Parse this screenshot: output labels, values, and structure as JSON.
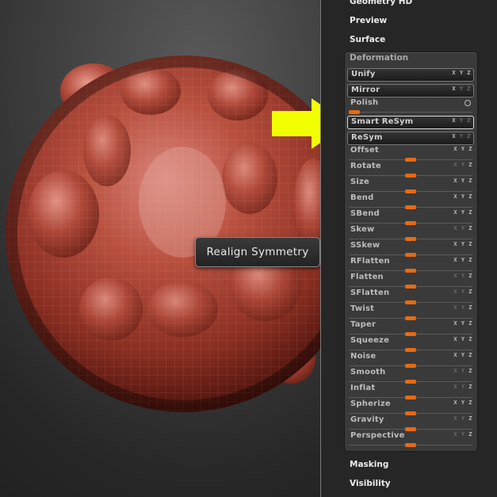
{
  "tooltip": {
    "text": "Realign Symmetry"
  },
  "palette": {
    "above": [
      "Geometry HD",
      "Preview",
      "Surface"
    ],
    "below": [
      "Masking",
      "Visibility"
    ]
  },
  "deformation": {
    "title": "Deformation",
    "buttons": [
      {
        "label": "Unify",
        "axes": "XYZ"
      },
      {
        "label": "Mirror",
        "axes": "XYZ"
      },
      {
        "label": "Polish",
        "type": "slider",
        "value": 0.05
      },
      {
        "label": "Smart ReSym",
        "axes": "XYZ",
        "highlight": true
      },
      {
        "label": "ReSym",
        "axes": "XYZ"
      }
    ],
    "sliders": [
      {
        "label": "Offset",
        "axes": "XYZ",
        "value": 0.5
      },
      {
        "label": "Rotate",
        "axes": "XYZ",
        "value": 0.5
      },
      {
        "label": "Size",
        "axes": "XYZ",
        "value": 0.5
      },
      {
        "label": "Bend",
        "axes": "XYZ",
        "value": 0.5
      },
      {
        "label": "SBend",
        "axes": "XYZ",
        "value": 0.5
      },
      {
        "label": "Skew",
        "axes": "XYZ",
        "value": 0.5
      },
      {
        "label": "SSkew",
        "axes": "XYZ",
        "value": 0.5
      },
      {
        "label": "RFlatten",
        "axes": "XYZ",
        "value": 0.5
      },
      {
        "label": "Flatten",
        "axes": "XYZ",
        "value": 0.5
      },
      {
        "label": "SFlatten",
        "axes": "XYZ",
        "value": 0.5
      },
      {
        "label": "Twist",
        "axes": "XYZ",
        "value": 0.5
      },
      {
        "label": "Taper",
        "axes": "XYZ",
        "value": 0.5
      },
      {
        "label": "Squeeze",
        "axes": "XYZ",
        "value": 0.5
      },
      {
        "label": "Noise",
        "axes": "XYZ",
        "value": 0.5
      },
      {
        "label": "Smooth",
        "axes": "XYZ",
        "value": 0.5
      },
      {
        "label": "Inflat",
        "axes": "XYZ",
        "value": 0.5
      },
      {
        "label": "Spherize",
        "axes": "XYZ",
        "value": 0.5
      },
      {
        "label": "Gravity",
        "axes": "XYZ",
        "value": 0.5
      },
      {
        "label": "Perspective",
        "axes": "XYZ",
        "value": 0.5
      }
    ]
  },
  "colors": {
    "accent": "#e86a10",
    "arrow": "#f2ff00",
    "model": "#b24a3c"
  }
}
